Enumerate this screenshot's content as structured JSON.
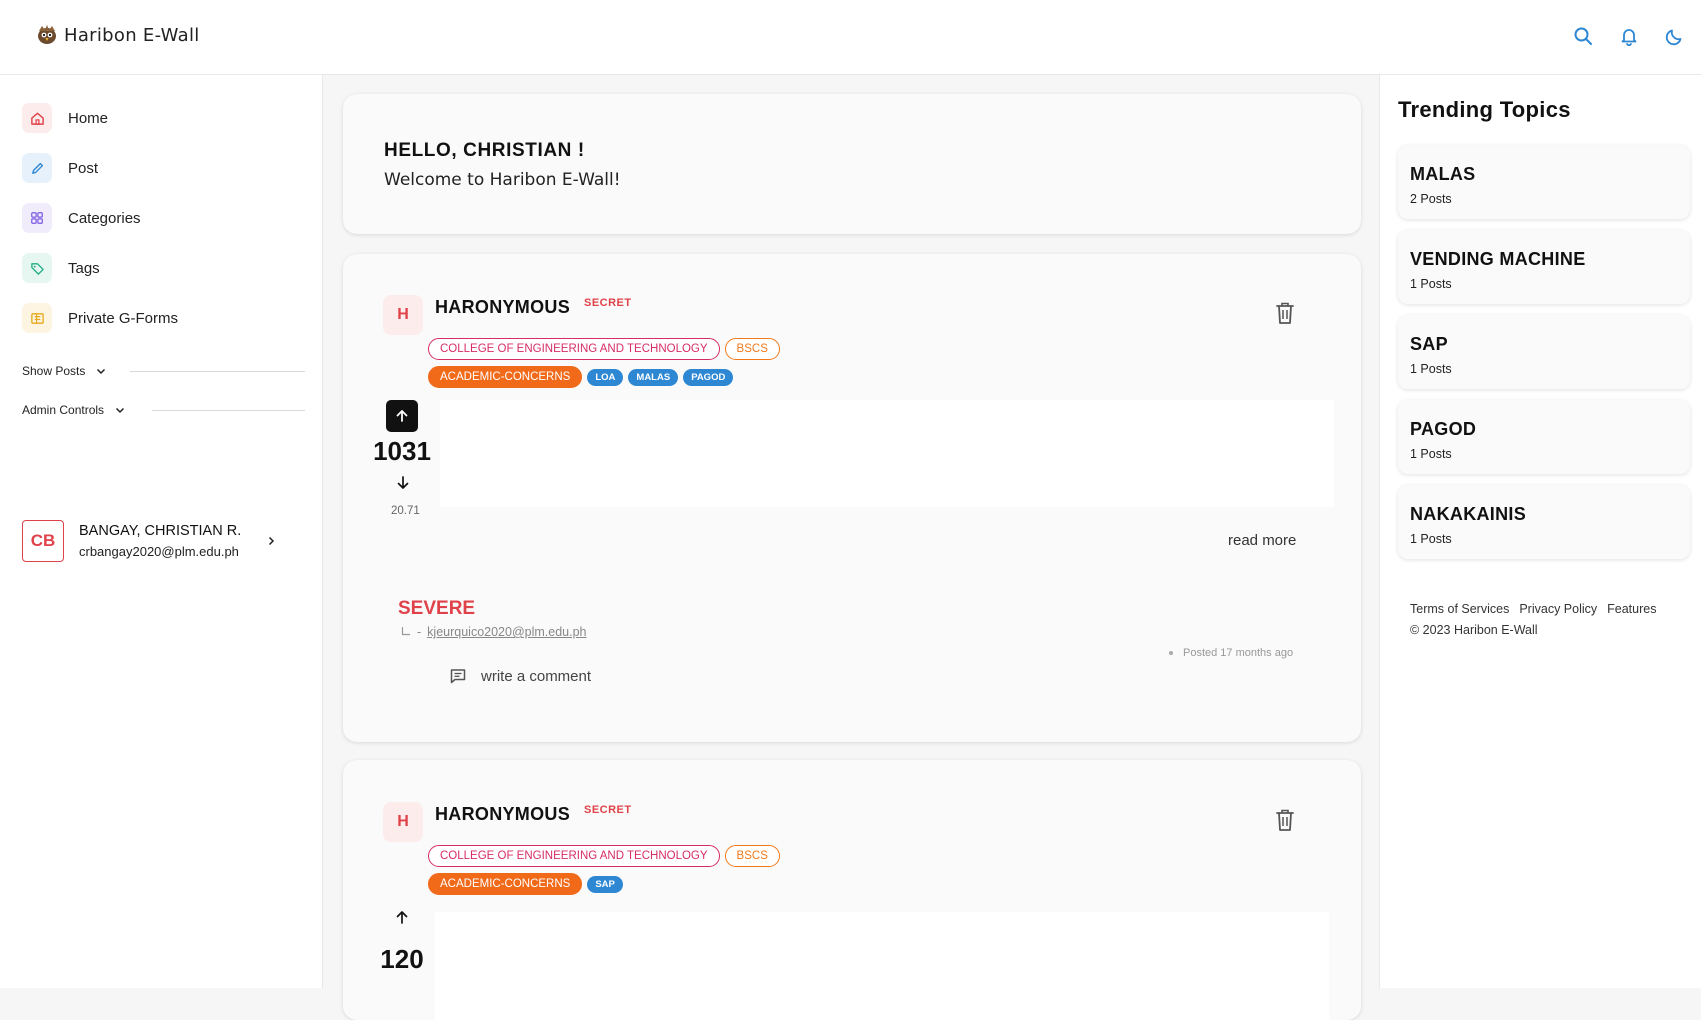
{
  "app": {
    "name": "Haribon E-Wall"
  },
  "topbar": {
    "icons": [
      "search-icon",
      "bell-icon",
      "moon-icon"
    ],
    "accent": "#2d87d3"
  },
  "sidebar": {
    "nav": [
      {
        "label": "Home",
        "icon": "home-icon",
        "color": "#e0424a",
        "bg": "#fdecec"
      },
      {
        "label": "Post",
        "icon": "pencil-icon",
        "color": "#2d87d3",
        "bg": "#e7f1fb"
      },
      {
        "label": "Categories",
        "icon": "grid-icon",
        "color": "#7a5ae0",
        "bg": "#f0ecfc"
      },
      {
        "label": "Tags",
        "icon": "tag-icon",
        "color": "#1fae84",
        "bg": "#e6f6f0"
      },
      {
        "label": "Private G-Forms",
        "icon": "form-icon",
        "color": "#e6a81c",
        "bg": "#fdf5e1"
      }
    ],
    "show_posts": "Show Posts",
    "admin_controls": "Admin Controls",
    "user": {
      "initials": "CB",
      "name": "BANGAY, CHRISTIAN R.",
      "email": "crbangay2020@plm.edu.ph"
    }
  },
  "welcome": {
    "title": "HELLO, CHRISTIAN !",
    "subtitle": "Welcome to Haribon E-Wall!"
  },
  "posts": [
    {
      "avatar": "H",
      "author": "HARONYMOUS",
      "visibility": "SECRET",
      "college": "COLLEGE OF ENGINEERING AND TECHNOLOGY",
      "program": "BSCS",
      "category": "ACADEMIC-CONCERNS",
      "tags": [
        "LOA",
        "MALAS",
        "PAGOD"
      ],
      "votes": "1031",
      "score": "20.71",
      "read_more": "read more",
      "severity": "SEVERE",
      "reply_prefix": "-",
      "reply_email": "kjeurquico2020@plm.edu.ph",
      "posted": "Posted 17 months ago",
      "comment": "write a comment"
    },
    {
      "avatar": "H",
      "author": "HARONYMOUS",
      "visibility": "SECRET",
      "college": "COLLEGE OF ENGINEERING AND TECHNOLOGY",
      "program": "BSCS",
      "category": "ACADEMIC-CONCERNS",
      "tags": [
        "SAP"
      ],
      "votes": "120"
    }
  ],
  "trending": {
    "title": "Trending Topics",
    "topics": [
      {
        "name": "MALAS",
        "count": "2 Posts"
      },
      {
        "name": "VENDING MACHINE",
        "count": "1 Posts"
      },
      {
        "name": "SAP",
        "count": "1 Posts"
      },
      {
        "name": "PAGOD",
        "count": "1 Posts"
      },
      {
        "name": "NAKAKAINIS",
        "count": "1 Posts"
      }
    ],
    "footer_links": [
      "Terms of Services",
      "Privacy Policy",
      "Features"
    ],
    "copyright": "© 2023 Haribon E-Wall"
  }
}
